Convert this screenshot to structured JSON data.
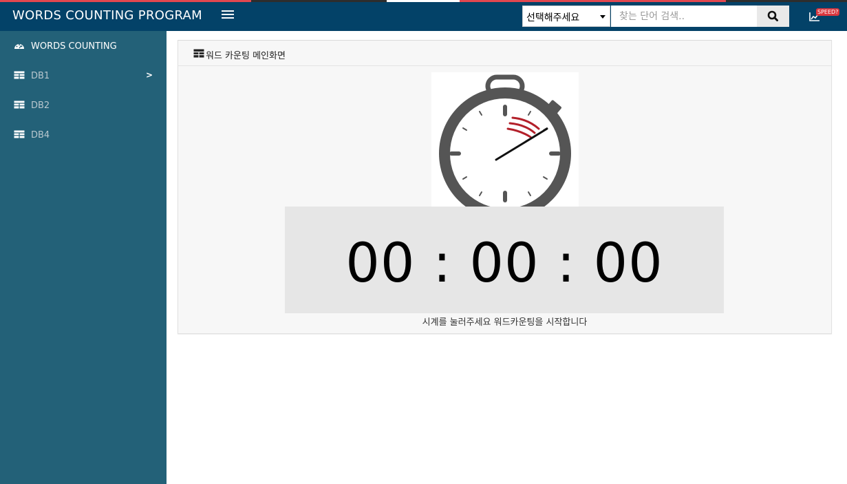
{
  "colors": {
    "navbar": "#034268",
    "sidebar": "#236178",
    "accent_red": "#e2474f",
    "badge_red": "#d9363e",
    "timer_bg": "#e6e6e6",
    "watch_body": "#555555",
    "watch_needle_red": "#b3202a"
  },
  "navbar": {
    "brand": "WORDS COUNTING PROGRAM",
    "menu_icon": "hamburger-icon",
    "select_value": "선택해주세요",
    "search_placeholder": "찾는 단어 검색..",
    "search_icon": "search-icon",
    "right_icon": "chart-icon",
    "speed_badge": "SPEED?"
  },
  "sidebar": {
    "items": [
      {
        "label": "WORDS COUNTING",
        "icon": "dashboard-icon",
        "active": true,
        "has_submenu": false
      },
      {
        "label": "DB1",
        "icon": "table-icon",
        "active": false,
        "has_submenu": true,
        "chevron": ">"
      },
      {
        "label": "DB2",
        "icon": "table-icon",
        "active": false,
        "has_submenu": false
      },
      {
        "label": "DB4",
        "icon": "table-icon",
        "active": false,
        "has_submenu": false
      }
    ]
  },
  "main": {
    "box_title": "워드 카운팅 메인화면",
    "box_icon": "table-icon",
    "stopwatch_icon": "stopwatch-icon",
    "timer": "00 : 00 : 00",
    "hint": "시계를 눌러주세요 워드카운팅을 시작합니다"
  }
}
